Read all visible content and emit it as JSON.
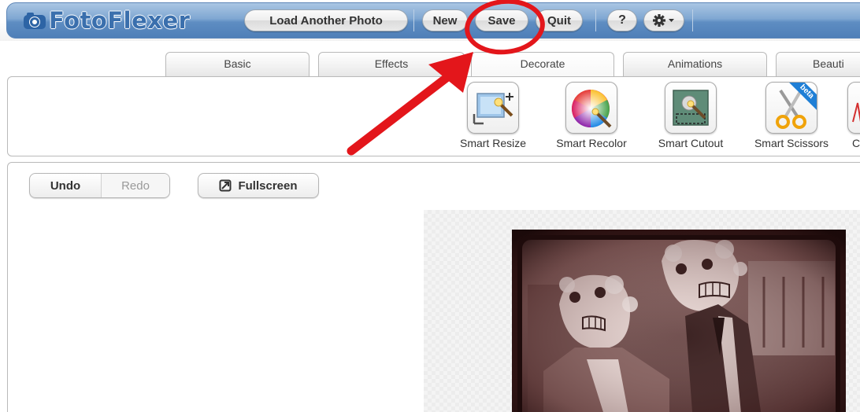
{
  "app": {
    "logo_text": "FotoFlexer",
    "brand_color": "#3a6fad",
    "header_color": "#6f9acb"
  },
  "header": {
    "load_label": "Load Another Photo",
    "new_label": "New",
    "save_label": "Save",
    "quit_label": "Quit",
    "help_label": "?",
    "settings_icon": "gear-dropdown-icon"
  },
  "tabs": [
    {
      "label": "Basic"
    },
    {
      "label": "Effects"
    },
    {
      "label": "Decorate"
    },
    {
      "label": "Animations"
    },
    {
      "label": "Beauti"
    }
  ],
  "tools": [
    {
      "label": "Smart Resize",
      "icon": "smart-resize-icon"
    },
    {
      "label": "Smart Recolor",
      "icon": "color-wheel-icon"
    },
    {
      "label": "Smart Cutout",
      "icon": "cutout-icon"
    },
    {
      "label": "Smart Scissors",
      "icon": "scissors-icon",
      "badge": "beta"
    },
    {
      "label": "C",
      "icon": "partial-tool-icon"
    }
  ],
  "edit": {
    "undo_label": "Undo",
    "redo_label": "Redo",
    "fullscreen_label": "Fullscreen"
  },
  "annotation": {
    "color": "#e3161b"
  }
}
